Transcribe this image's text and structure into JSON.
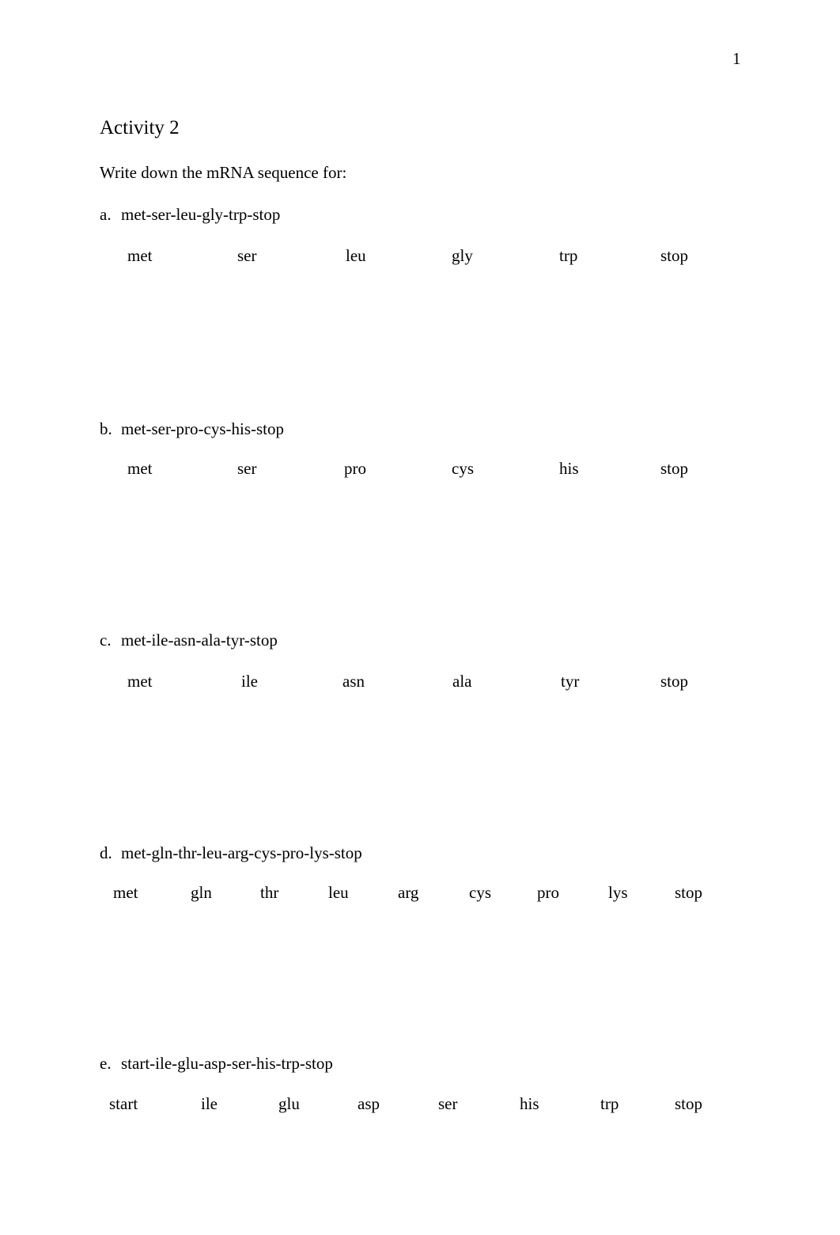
{
  "page_number": "1",
  "title": "Activity 2",
  "instruction": "Write down the mRNA sequence for:",
  "questions": [
    {
      "letter": "a.",
      "sequence": "met-ser-leu-gly-trp-stop",
      "codons": [
        "met",
        "ser",
        "leu",
        "gly",
        "trp",
        "stop"
      ]
    },
    {
      "letter": "b.",
      "sequence": "met-ser-pro-cys-his-stop",
      "codons": [
        "met",
        "ser",
        "pro",
        "cys",
        "his",
        "stop"
      ]
    },
    {
      "letter": "c.",
      "sequence": "met-ile-asn-ala-tyr-stop",
      "codons": [
        "met",
        "ile",
        "asn",
        "ala",
        "tyr",
        "stop"
      ]
    },
    {
      "letter": "d.",
      "sequence": "met-gln-thr-leu-arg-cys-pro-lys-stop",
      "codons": [
        "met",
        "gln",
        "thr",
        "leu",
        "arg",
        "cys",
        "pro",
        "lys",
        "stop"
      ]
    },
    {
      "letter": "e.",
      "sequence": "start-ile-glu-asp-ser-his-trp-stop",
      "codons": [
        "start",
        "ile",
        "glu",
        "asp",
        "ser",
        "his",
        "trp",
        "stop"
      ]
    }
  ]
}
